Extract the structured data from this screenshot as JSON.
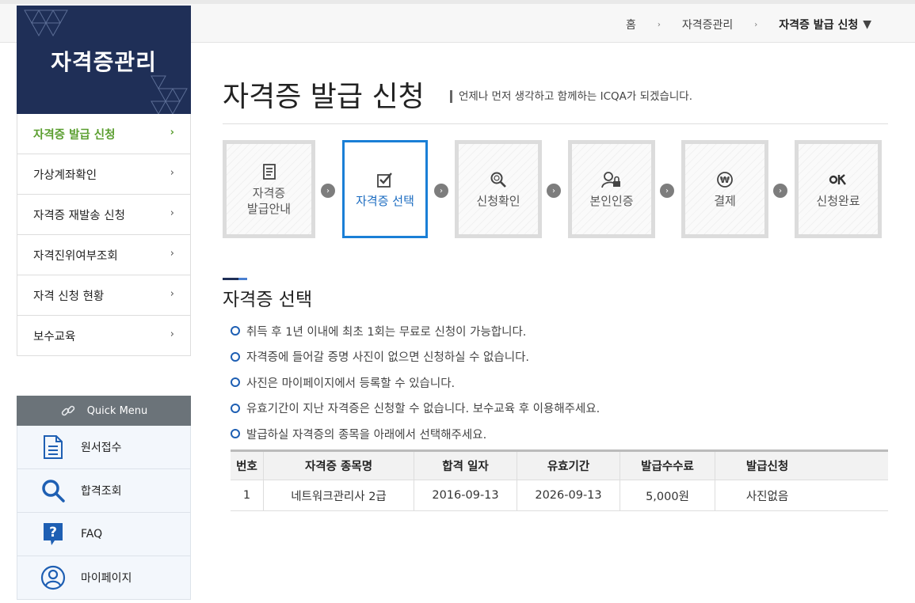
{
  "breadcrumb": {
    "home": "홈",
    "level1": "자격증관리",
    "current": "자격증 발급 신청",
    "dropdown_icon": "triangle-down-icon"
  },
  "sidebar": {
    "title": "자격증관리",
    "items": [
      {
        "label": "자격증 발급 신청",
        "active": true
      },
      {
        "label": "가상계좌확인"
      },
      {
        "label": "자격증 재발송 신청"
      },
      {
        "label": "자격진위여부조회"
      },
      {
        "label": "자격 신청 현황"
      },
      {
        "label": "보수교육"
      }
    ],
    "chevron": "›"
  },
  "quick_menu": {
    "title": "Quick Menu",
    "items": [
      {
        "label": "원서접수",
        "icon": "document-icon"
      },
      {
        "label": "합격조회",
        "icon": "search-icon"
      },
      {
        "label": "FAQ",
        "icon": "question-icon"
      },
      {
        "label": "마이페이지",
        "icon": "user-icon"
      }
    ]
  },
  "main": {
    "title": "자격증 발급 신청",
    "subtitle": "언제나 먼저 생각하고 함께하는 ICQA가 되겠습니다.",
    "steps": [
      {
        "label": "자격증\n발급안내",
        "icon": "document-icon"
      },
      {
        "label": "자격증 선택",
        "icon": "checkbox-icon",
        "active": true
      },
      {
        "label": "신청확인",
        "icon": "search-icon"
      },
      {
        "label": "본인인증",
        "icon": "user-lock-icon"
      },
      {
        "label": "결제",
        "icon": "won-icon"
      },
      {
        "label": "신청완료",
        "icon": "ok-icon"
      }
    ],
    "section_title": "자격증 선택",
    "notes": [
      "취득 후 1년 이내에 최초 1회는 무료로 신청이 가능합니다.",
      "자격증에 들어갈 증명 사진이 없으면 신청하실 수 없습니다.",
      "사진은 마이페이지에서 등록할 수 있습니다.",
      "유효기간이 지난 자격증은 신청할 수 없습니다. 보수교육 후 이용해주세요.",
      "발급하실 자격증의 종목을 아래에서 선택해주세요."
    ],
    "table": {
      "headers": [
        "번호",
        "자격증 종목명",
        "합격 일자",
        "유효기간",
        "발급수수료",
        "발급신청"
      ],
      "rows": [
        [
          "1",
          "네트워크관리사 2급",
          "2016-09-13",
          "2026-09-13",
          "5,000원",
          "사진없음"
        ]
      ]
    }
  },
  "colors": {
    "sidebar_bg": "#1f2f57",
    "active_green": "#5a9e2f",
    "active_blue": "#1a7fd6",
    "quick_head": "#6b7379"
  }
}
